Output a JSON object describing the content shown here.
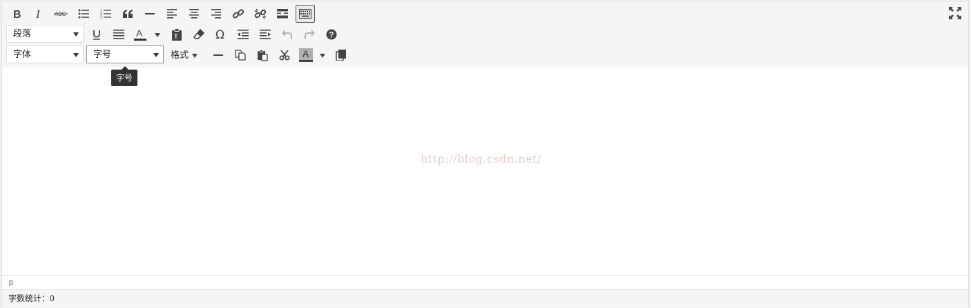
{
  "toolbar": {
    "row1": [
      {
        "name": "bold-button",
        "icon": "bold-icon"
      },
      {
        "name": "italic-button",
        "icon": "italic-icon"
      },
      {
        "name": "strikethrough-button",
        "icon": "strikethrough-icon"
      },
      {
        "name": "bullet-list-button",
        "icon": "bullet-list-icon"
      },
      {
        "name": "numbered-list-button",
        "icon": "numbered-list-icon"
      },
      {
        "name": "blockquote-button",
        "icon": "quote-icon"
      },
      {
        "name": "horizontal-rule-button",
        "icon": "horizontal-rule-icon"
      },
      {
        "name": "align-left-button",
        "icon": "align-left-icon"
      },
      {
        "name": "align-center-button",
        "icon": "align-center-icon"
      },
      {
        "name": "align-right-button",
        "icon": "align-right-icon"
      },
      {
        "name": "insert-link-button",
        "icon": "link-icon"
      },
      {
        "name": "remove-link-button",
        "icon": "unlink-icon"
      },
      {
        "name": "read-more-button",
        "icon": "read-more-icon"
      },
      {
        "name": "toolbar-toggle-button",
        "icon": "keyboard-icon",
        "active": true
      }
    ],
    "paragraph_select": "段落",
    "font_family_select": "字体",
    "font_size_select": "字号",
    "format_menu_label": "格式",
    "fullscreen_icon": "fullscreen-icon"
  },
  "tooltip": "字号",
  "content": {
    "watermark": "http://blog.csdn.net/"
  },
  "path_bar": "p",
  "status": {
    "word_count": "字数统计：0"
  },
  "colors": {
    "toolbar_bg": "#f5f5f5",
    "icon": "#444444",
    "disabled_icon": "#b4b4b4",
    "tooltip_bg": "#333333",
    "text_color_underline": "#333333",
    "bg_color_underline": "#444444"
  }
}
